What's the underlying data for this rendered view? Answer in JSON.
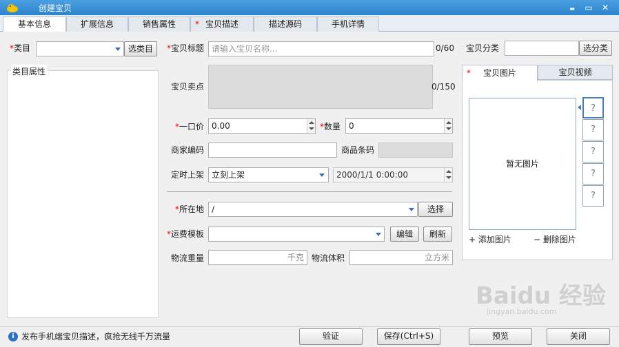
{
  "window": {
    "title": "创建宝贝",
    "minimize": "▬",
    "maximize": "▭",
    "close": "✕"
  },
  "tabs": [
    {
      "label": "基本信息",
      "active": true,
      "required": false
    },
    {
      "label": "扩展信息",
      "active": false,
      "required": false
    },
    {
      "label": "销售属性",
      "active": false,
      "required": false
    },
    {
      "label": "宝贝描述",
      "active": false,
      "required": true
    },
    {
      "label": "描述源码",
      "active": false,
      "required": false
    },
    {
      "label": "手机详情",
      "active": false,
      "required": false
    }
  ],
  "required_mark": "*",
  "left": {
    "category_label": "类目",
    "category_value": "",
    "select_category_btn": "选类目",
    "attributes_label": "类目属性"
  },
  "form": {
    "title_label": "宝贝标题",
    "title_placeholder": "请输入宝贝名称...",
    "title_count": "0/60",
    "selling_point_label": "宝贝卖点",
    "selling_point_count": "0/150",
    "price_label": "一口价",
    "price_value": "0.00",
    "quantity_label": "数量",
    "quantity_value": "0",
    "merchant_code_label": "商家编码",
    "merchant_code_value": "",
    "barcode_label": "商品条码",
    "schedule_label": "定时上架",
    "schedule_value": "立刻上架",
    "schedule_datetime": "2000/1/1 0:00:00",
    "location_label": "所在地",
    "location_value": "/",
    "location_btn": "选择",
    "shipping_label": "运费模板",
    "shipping_value": "",
    "edit_btn": "编辑",
    "refresh_btn": "刷新",
    "weight_label": "物流重量",
    "weight_unit": "千克",
    "volume_label": "物流体积",
    "volume_unit": "立方米"
  },
  "right": {
    "shop_category_label": "宝贝分类",
    "shop_category_value": "",
    "shop_category_btn": "选分类",
    "tab_images": "宝贝图片",
    "tab_video": "宝贝视频",
    "no_image": "暂无图片",
    "thumb_placeholder": "?",
    "add_image": "添加图片",
    "delete_image": "删除图片",
    "add_icon": "+",
    "delete_icon": "−"
  },
  "status": {
    "info_icon": "i",
    "message": "发布手机端宝贝描述，疯抢无线千万流量",
    "verify_btn": "验证",
    "save_btn": "保存(Ctrl+S)",
    "preview_btn": "预览",
    "close_btn": "关闭"
  },
  "watermark": {
    "brand": "Baidu 经验",
    "url": "jingyan.baidu.com"
  }
}
